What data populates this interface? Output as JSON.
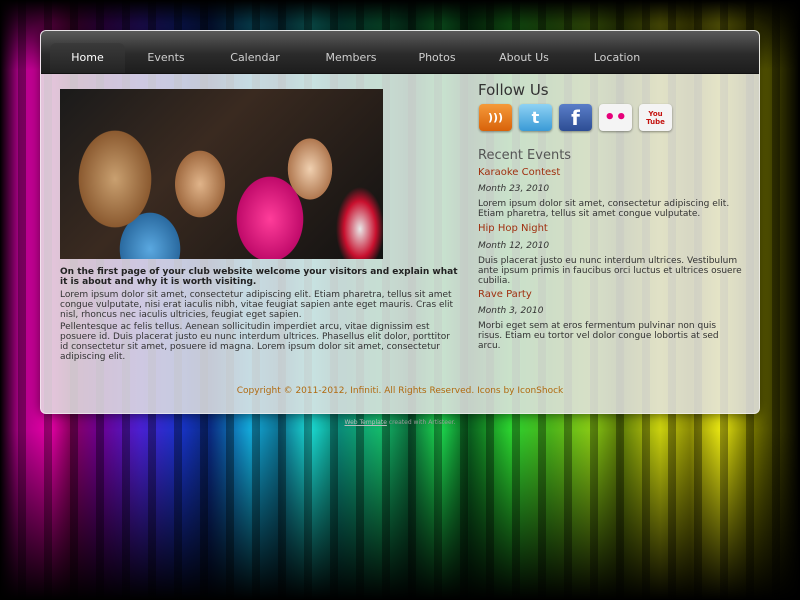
{
  "nav": {
    "items": [
      {
        "label": "Home",
        "active": true
      },
      {
        "label": "Events",
        "active": false
      },
      {
        "label": "Calendar",
        "active": false
      },
      {
        "label": "Members",
        "active": false
      },
      {
        "label": "Photos",
        "active": false
      },
      {
        "label": "About Us",
        "active": false
      },
      {
        "label": "Location",
        "active": false
      }
    ]
  },
  "main": {
    "intro": "On the first page of your club website welcome your visitors and explain what it is about and why it is worth visiting.",
    "paragraph1": "Lorem ipsum dolor sit amet, consectetur adipiscing elit. Etiam pharetra, tellus sit amet congue vulputate, nisi erat iaculis nibh, vitae feugiat sapien ante eget mauris. Cras elit nisl, rhoncus nec iaculis ultricies, feugiat eget sapien.",
    "paragraph2": "Pellentesque ac felis tellus. Aenean sollicitudin imperdiet arcu, vitae dignissim est posuere id. Duis placerat justo eu nunc interdum ultrices. Phasellus elit dolor, porttitor id consectetur sit amet, posuere id magna. Lorem ipsum dolor sit amet, consectetur adipiscing elit."
  },
  "sidebar": {
    "follow_title": "Follow Us",
    "social": [
      {
        "icon": "rss-icon",
        "glyph": ")))",
        "color": "#e8761a"
      },
      {
        "icon": "twitter-icon",
        "glyph": "t",
        "color": "#3aa8e0"
      },
      {
        "icon": "facebook-icon",
        "glyph": "f",
        "color": "#3b5ea8"
      },
      {
        "icon": "flickr-icon",
        "glyph": "••",
        "color": "#f2f2f2"
      },
      {
        "icon": "youtube-icon",
        "glyph": "You Tube",
        "color": "#f2f2f2"
      }
    ],
    "recent_title": "Recent Events",
    "events": [
      {
        "title": "Karaoke Contest",
        "date": "Month 23, 2010",
        "text": "Lorem ipsum dolor sit amet, consectetur adipiscing elit. Etiam pharetra, tellus sit amet congue vulputate."
      },
      {
        "title": "Hip Hop Night",
        "date": "Month 12, 2010",
        "text": "Duis placerat justo eu nunc interdum ultrices. Vestibulum ante ipsum primis in faucibus orci luctus et ultrices osuere cubilia."
      },
      {
        "title": "Rave Party",
        "date": "Month 3, 2010",
        "text": "Morbi eget sem at eros fermentum pulvinar non quis risus. Etiam eu tortor vel dolor congue lobortis at sed arcu."
      }
    ]
  },
  "footer": {
    "copyright": "Copyright © 2011-2012, Infiniti. All Rights Reserved. Icons by IconShock",
    "credit_link": "Web Template",
    "credit_rest": " created with Artisteer."
  }
}
